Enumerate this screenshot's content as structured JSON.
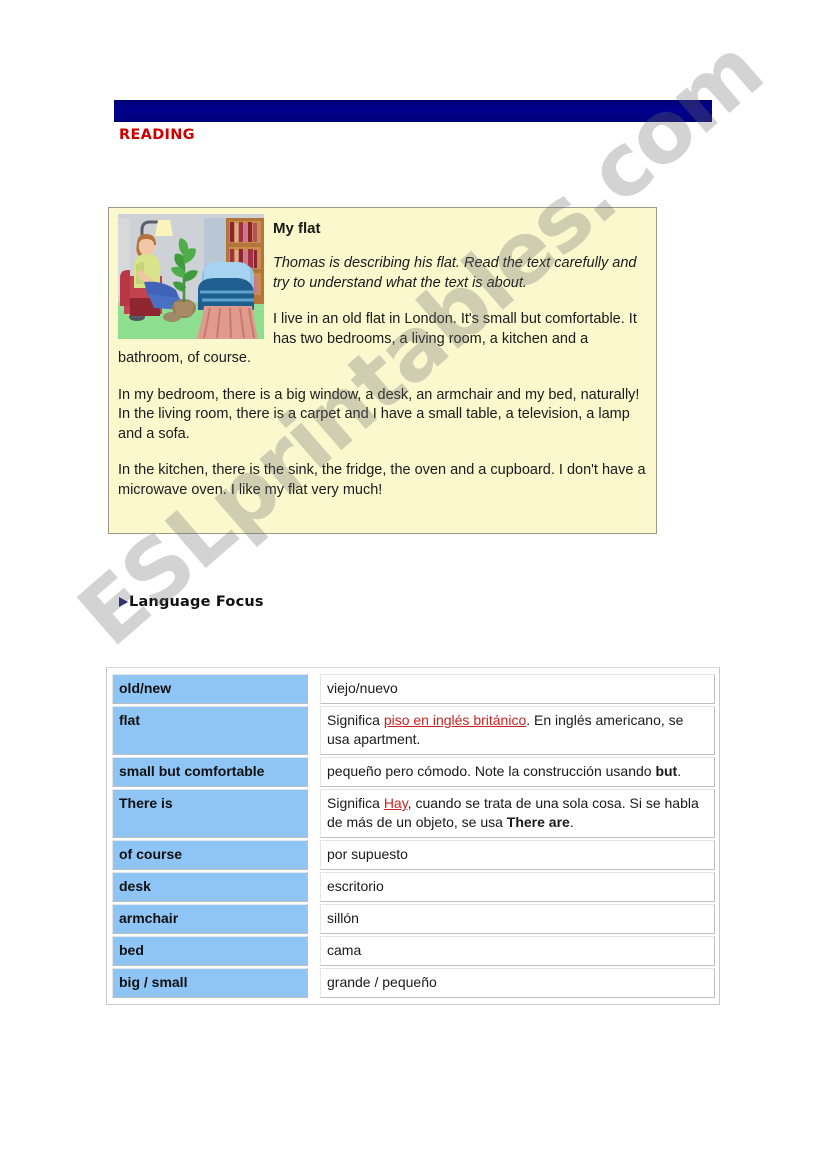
{
  "page": {
    "background_color": "#ffffff",
    "watermark_text": "ESLprintables.com"
  },
  "header": {
    "bar_color": "#000080",
    "section_title": "READING",
    "section_title_color": "#cc0000"
  },
  "reading_box": {
    "background_color": "#fbf8cd",
    "border_color": "#9a9a8c",
    "illustration_alt": "living-room-illustration",
    "title": "My flat",
    "instructions": "Thomas is describing his flat. Read the text carefully and try to understand what the text is about.",
    "paragraphs": [
      "I live in an old flat in London. It's small but comfortable. It has two bedrooms, a living room, a kitchen and a bathroom, of course.",
      "In my bedroom, there is a big window, a desk, an armchair and my bed, naturally! In the living room, there is a carpet and I have a small table, a television, a lamp and a sofa.",
      "In the kitchen, there is the sink, the fridge, the oven and a cupboard. I don't have a microwave oven. I like my flat very much!"
    ]
  },
  "language_focus": {
    "label": "Language Focus"
  },
  "vocab_table": {
    "term_cell_color": "#8ec5f5",
    "highlight_color": "#cc2222",
    "rows": [
      {
        "term": "old/new",
        "definition_parts": [
          {
            "text": "viejo/nuevo",
            "style": "plain"
          }
        ]
      },
      {
        "term": "flat",
        "definition_parts": [
          {
            "text": "Significa ",
            "style": "plain"
          },
          {
            "text": "piso en inglés británico",
            "style": "highlight"
          },
          {
            "text": ". En inglés americano, se usa apartment.",
            "style": "plain"
          }
        ]
      },
      {
        "term": "small but comfortable",
        "definition_parts": [
          {
            "text": "pequeño pero cómodo. Note la construcción usando ",
            "style": "plain"
          },
          {
            "text": "but",
            "style": "bold"
          },
          {
            "text": ".",
            "style": "plain"
          }
        ]
      },
      {
        "term": "There is",
        "definition_parts": [
          {
            "text": "Significa ",
            "style": "plain"
          },
          {
            "text": "Hay",
            "style": "highlight"
          },
          {
            "text": ", cuando se trata de una sola cosa. Si se habla de más de un objeto, se usa ",
            "style": "plain"
          },
          {
            "text": "There are",
            "style": "bold"
          },
          {
            "text": ".",
            "style": "plain"
          }
        ]
      },
      {
        "term": "of course",
        "definition_parts": [
          {
            "text": "por supuesto",
            "style": "plain"
          }
        ]
      },
      {
        "term": "desk",
        "definition_parts": [
          {
            "text": "escritorio",
            "style": "plain"
          }
        ]
      },
      {
        "term": "armchair",
        "definition_parts": [
          {
            "text": "sillón",
            "style": "plain"
          }
        ]
      },
      {
        "term": "bed",
        "definition_parts": [
          {
            "text": "cama",
            "style": "plain"
          }
        ]
      },
      {
        "term": "big / small",
        "definition_parts": [
          {
            "text": "grande / pequeño",
            "style": "plain"
          }
        ]
      }
    ]
  }
}
